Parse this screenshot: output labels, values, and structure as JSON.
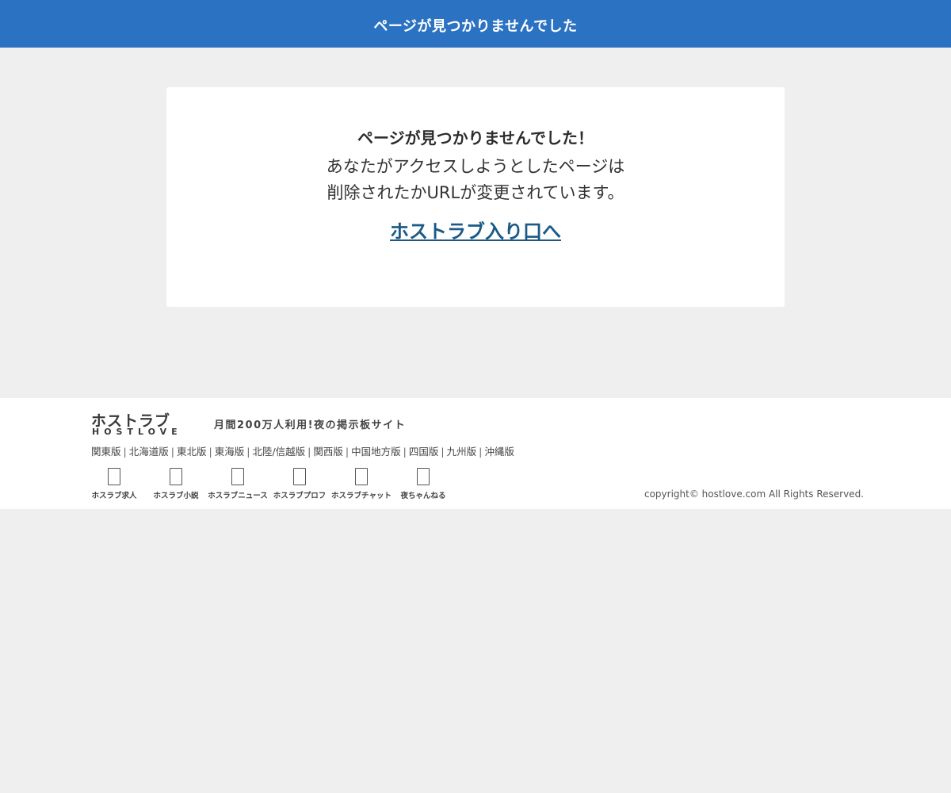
{
  "header": {
    "title": "ページが見つかりませんでした"
  },
  "card": {
    "heading": "ページが見つかりませんでした！",
    "line1": "あなたがアクセスしようとしたページは",
    "line2": "削除されたかURLが変更されています。",
    "link_label": "ホストラブ入り口へ"
  },
  "footer": {
    "logo_jp": "ホストラブ",
    "logo_en": "HOSTLOVE",
    "tagline": "月間200万人利用!夜の掲示板サイト",
    "regions": [
      "関東版",
      "北海道版",
      "東北版",
      "東海版",
      "北陸/信越版",
      "関西版",
      "中国地方版",
      "四国版",
      "九州版",
      "沖縄版"
    ],
    "services": [
      {
        "label": "ホスラブ求人",
        "icon": "job-icon"
      },
      {
        "label": "ホスラブ小説",
        "icon": "novel-icon"
      },
      {
        "label": "ホスラブニュース",
        "icon": "news-icon"
      },
      {
        "label": "ホスラブプロフ",
        "icon": "profile-icon"
      },
      {
        "label": "ホスラブチャット",
        "icon": "chat-icon"
      },
      {
        "label": "夜ちゃんねる",
        "icon": "channel-icon"
      }
    ],
    "copyright": "copyright© hostlove.com All Rights Reserved."
  },
  "colors": {
    "header_bg": "#2b72c2",
    "link": "#1b5a86",
    "page_bg": "#efefef"
  }
}
